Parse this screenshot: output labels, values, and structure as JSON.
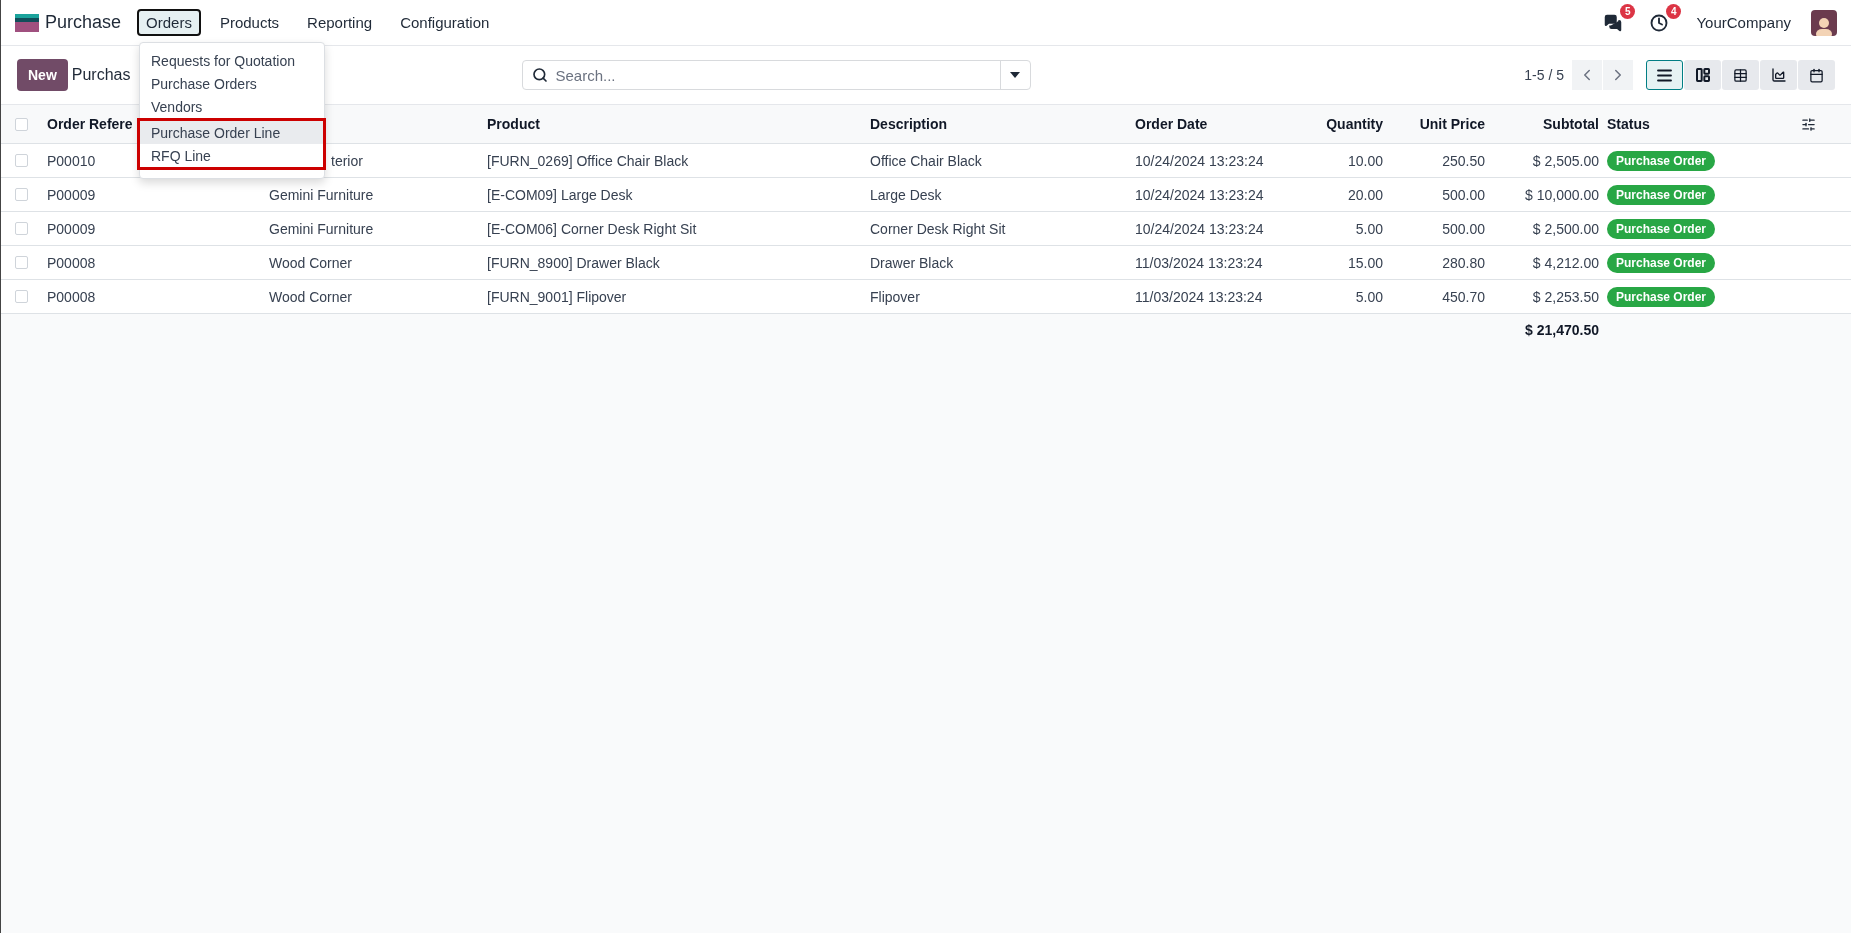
{
  "app": {
    "name": "Purchase"
  },
  "menu": [
    {
      "label": "Orders",
      "selected": true
    },
    {
      "label": "Products",
      "selected": false
    },
    {
      "label": "Reporting",
      "selected": false
    },
    {
      "label": "Configuration",
      "selected": false
    }
  ],
  "dropdown": [
    {
      "label": "Requests for Quotation",
      "hovered": false,
      "highlighted": false
    },
    {
      "label": "Purchase Orders",
      "hovered": false,
      "highlighted": false
    },
    {
      "label": "Vendors",
      "hovered": false,
      "highlighted": false
    },
    {
      "label": "Purchase Order Line",
      "hovered": true,
      "highlighted": true
    },
    {
      "label": "RFQ Line",
      "hovered": false,
      "highlighted": true
    }
  ],
  "systray": {
    "messages_count": "5",
    "activities_count": "4",
    "company": "YourCompany"
  },
  "control_panel": {
    "new_button": "New",
    "breadcrumb": "Purchas",
    "search": {
      "placeholder": "Search..."
    },
    "pager": "1-5 / 5",
    "views": [
      {
        "kind": "list",
        "selected": true
      },
      {
        "kind": "kanban",
        "selected": false
      },
      {
        "kind": "pivot",
        "selected": false
      },
      {
        "kind": "graph",
        "selected": false
      },
      {
        "kind": "calendar",
        "selected": false
      }
    ]
  },
  "table": {
    "select_all_checked": false,
    "headers": {
      "order_reference": "Order Refere",
      "product": "Product",
      "description": "Description",
      "order_date": "Order Date",
      "quantity": "Quantity",
      "unit_price": "Unit Price",
      "subtotal": "Subtotal",
      "status": "Status"
    },
    "rows": [
      {
        "checked": false,
        "order_reference": "P00010",
        "vendor": "terior",
        "product": "[FURN_0269] Office Chair Black",
        "description": "Office Chair Black",
        "order_date": "10/24/2024 13:23:24",
        "quantity": "10.00",
        "unit_price": "250.50",
        "subtotal": "$ 2,505.00",
        "status": "Purchase Order"
      },
      {
        "checked": false,
        "order_reference": "P00009",
        "vendor": "Gemini Furniture",
        "product": "[E-COM09] Large Desk",
        "description": "Large Desk",
        "order_date": "10/24/2024 13:23:24",
        "quantity": "20.00",
        "unit_price": "500.00",
        "subtotal": "$ 10,000.00",
        "status": "Purchase Order"
      },
      {
        "checked": false,
        "order_reference": "P00009",
        "vendor": "Gemini Furniture",
        "product": "[E-COM06] Corner Desk Right Sit",
        "description": "Corner Desk Right Sit",
        "order_date": "10/24/2024 13:23:24",
        "quantity": "5.00",
        "unit_price": "500.00",
        "subtotal": "$ 2,500.00",
        "status": "Purchase Order"
      },
      {
        "checked": false,
        "order_reference": "P00008",
        "vendor": "Wood Corner",
        "product": "[FURN_8900] Drawer Black",
        "description": "Drawer Black",
        "order_date": "11/03/2024 13:23:24",
        "quantity": "15.00",
        "unit_price": "280.80",
        "subtotal": "$ 4,212.00",
        "status": "Purchase Order"
      },
      {
        "checked": false,
        "order_reference": "P00008",
        "vendor": "Wood Corner",
        "product": "[FURN_9001] Flipover",
        "description": "Flipover",
        "order_date": "11/03/2024 13:23:24",
        "quantity": "5.00",
        "unit_price": "450.70",
        "subtotal": "$ 2,253.50",
        "status": "Purchase Order"
      }
    ],
    "total": "$ 21,470.50"
  }
}
